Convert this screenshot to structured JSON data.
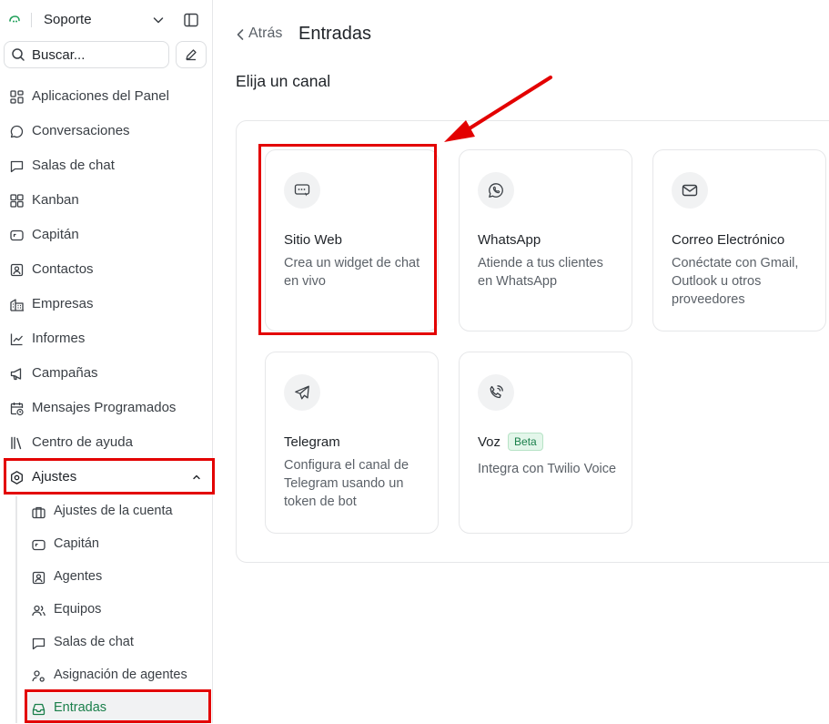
{
  "workspace": {
    "name": "Soporte"
  },
  "search": {
    "placeholder": "Buscar..."
  },
  "sidebar": {
    "items": [
      {
        "label": "Aplicaciones del Panel",
        "icon": "grid-icon"
      },
      {
        "label": "Conversaciones",
        "icon": "chat-bubble-icon"
      },
      {
        "label": "Salas de chat",
        "icon": "message-square-icon"
      },
      {
        "label": "Kanban",
        "icon": "kanban-icon"
      },
      {
        "label": "Capitán",
        "icon": "captain-icon"
      },
      {
        "label": "Contactos",
        "icon": "contact-icon"
      },
      {
        "label": "Empresas",
        "icon": "building-icon"
      },
      {
        "label": "Informes",
        "icon": "chart-icon"
      },
      {
        "label": "Campañas",
        "icon": "megaphone-icon"
      },
      {
        "label": "Mensajes Programados",
        "icon": "calendar-clock-icon"
      },
      {
        "label": "Centro de ayuda",
        "icon": "library-icon"
      },
      {
        "label": "Ajustes",
        "icon": "settings-icon"
      }
    ],
    "settings_sub": [
      {
        "label": "Ajustes de la cuenta",
        "icon": "briefcase-icon"
      },
      {
        "label": "Capitán",
        "icon": "captain-icon"
      },
      {
        "label": "Agentes",
        "icon": "agent-icon"
      },
      {
        "label": "Equipos",
        "icon": "team-icon"
      },
      {
        "label": "Salas de chat",
        "icon": "message-square-icon"
      },
      {
        "label": "Asignación de agentes",
        "icon": "user-cog-icon"
      },
      {
        "label": "Entradas",
        "icon": "inbox-icon"
      }
    ]
  },
  "header": {
    "back_label": "Atrás",
    "title": "Entradas"
  },
  "main": {
    "section_title": "Elija un canal",
    "channels": [
      {
        "title": "Sitio Web",
        "description": "Crea un widget de chat en vivo",
        "icon": "website-widget-icon"
      },
      {
        "title": "WhatsApp",
        "description": "Atiende a tus clientes en WhatsApp",
        "icon": "whatsapp-icon"
      },
      {
        "title": "Correo Electrónico",
        "description": "Conéctate con Gmail, Outlook u otros proveedores",
        "icon": "mail-icon"
      },
      {
        "title": "Telegram",
        "description": "Configura el canal de Telegram usando un token de bot",
        "icon": "telegram-icon"
      },
      {
        "title": "Voz",
        "badge": "Beta",
        "description": "Integra con Twilio Voice",
        "icon": "phone-voice-icon"
      }
    ]
  },
  "colors": {
    "accent": "#1a7f4a",
    "highlight": "#e30000",
    "border": "#e6e7e9"
  }
}
